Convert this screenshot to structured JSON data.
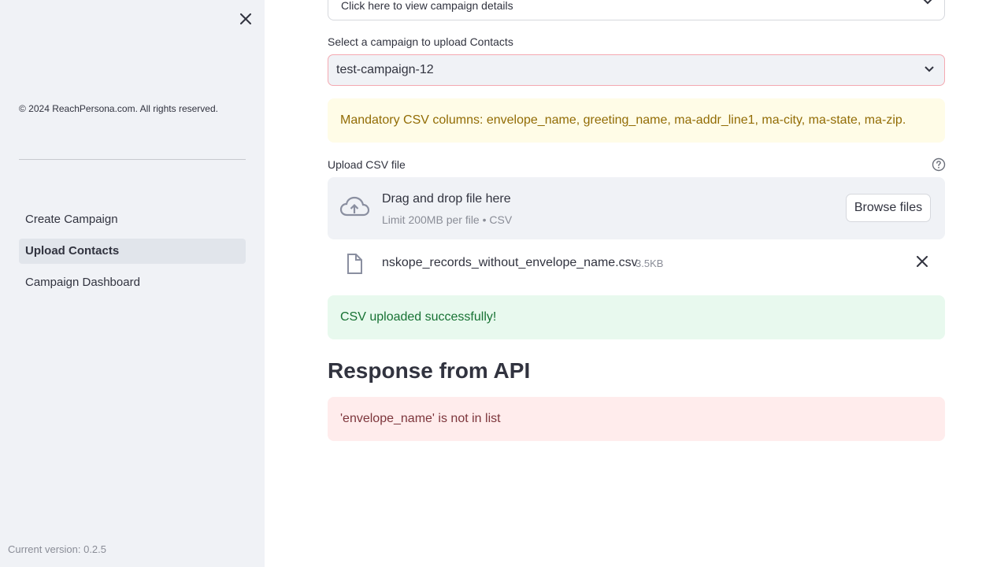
{
  "sidebar": {
    "copyright": "© 2024 ReachPersona.com. All rights reserved.",
    "nav_items": [
      {
        "label": "Create Campaign",
        "active": false
      },
      {
        "label": "Upload Contacts",
        "active": true
      },
      {
        "label": "Campaign Dashboard",
        "active": false
      }
    ],
    "version": "Current version: 0.2.5",
    "close_icon": "close-icon",
    "background": "#f0f2f6"
  },
  "main": {
    "expander_label": "Click here to view campaign details",
    "select_label": "Select a campaign to upload Contacts",
    "select_value": "test-campaign-12",
    "warning_text": "Mandatory CSV columns: envelope_name, greeting_name, ma-addr_line1, ma-city, ma-state, ma-zip.",
    "upload_label": "Upload CSV file",
    "dropzone": {
      "title": "Drag and drop file here",
      "subtitle": "Limit 200MB per file • CSV",
      "browse_label": "Browse files"
    },
    "file": {
      "name": "nskope_records_without_envelope_name.csv",
      "size": "3.5KB"
    },
    "success_text": "CSV uploaded successfully!",
    "response_heading": "Response from API",
    "error_text": "'envelope_name' is not in list"
  },
  "colors": {
    "warning_bg": "#fffce7",
    "warning_fg": "#926c05",
    "success_bg": "#e8f9ee",
    "success_fg": "#177233",
    "error_bg": "#ffecec",
    "error_fg": "#7d353b"
  }
}
